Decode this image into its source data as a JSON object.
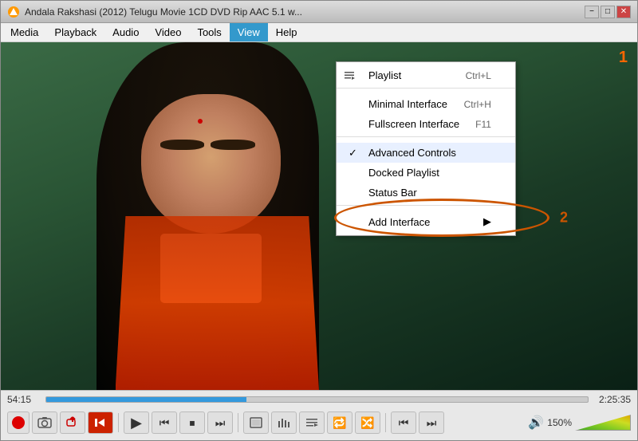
{
  "window": {
    "title": "Andala Rakshasi (2012) Telugu Movie 1CD DVD Rip AAC 5.1 w...",
    "icon": "▶"
  },
  "titlebar": {
    "minimize_label": "−",
    "maximize_label": "□",
    "close_label": "✕"
  },
  "menubar": {
    "items": [
      {
        "id": "media",
        "label": "Media"
      },
      {
        "id": "playback",
        "label": "Playback"
      },
      {
        "id": "audio",
        "label": "Audio"
      },
      {
        "id": "video",
        "label": "Video"
      },
      {
        "id": "tools",
        "label": "Tools"
      },
      {
        "id": "view",
        "label": "View",
        "active": true
      },
      {
        "id": "help",
        "label": "Help"
      }
    ]
  },
  "view_menu": {
    "items": [
      {
        "id": "playlist",
        "label": "Playlist",
        "shortcut": "Ctrl+L",
        "hasIcon": true,
        "icon": "≡"
      },
      {
        "id": "sep1",
        "separator": true
      },
      {
        "id": "minimal",
        "label": "Minimal Interface",
        "shortcut": "Ctrl+H"
      },
      {
        "id": "fullscreen",
        "label": "Fullscreen Interface",
        "shortcut": "F11"
      },
      {
        "id": "sep2",
        "separator": true
      },
      {
        "id": "advanced",
        "label": "Advanced Controls",
        "checked": true,
        "highlighted": true
      },
      {
        "id": "docked",
        "label": "Docked Playlist"
      },
      {
        "id": "status",
        "label": "Status Bar"
      },
      {
        "id": "sep3",
        "separator": true
      },
      {
        "id": "add_interface",
        "label": "Add Interface",
        "hasSubmenu": true
      }
    ]
  },
  "player": {
    "current_time": "54:15",
    "end_time": "2:25:35",
    "progress_percent": 37,
    "volume_percent": 150,
    "volume_label": "150%"
  },
  "annotations": {
    "step1": "1",
    "step2": "2"
  },
  "controls": {
    "record_title": "Record",
    "snapshot_title": "Snapshot",
    "loop_title": "Loop",
    "frame_prev_title": "Frame by Frame Previous",
    "play_title": "Play",
    "prev_title": "Previous",
    "stop_title": "Stop",
    "next_title": "Next",
    "fullscreen_title": "Fullscreen",
    "eq_title": "Equalizer",
    "playlist_title": "Playlist",
    "loop2_title": "Loop",
    "random_title": "Random",
    "prev_media_title": "Previous Media",
    "next_media_title": "Next Media",
    "volume_icon_title": "Volume"
  }
}
